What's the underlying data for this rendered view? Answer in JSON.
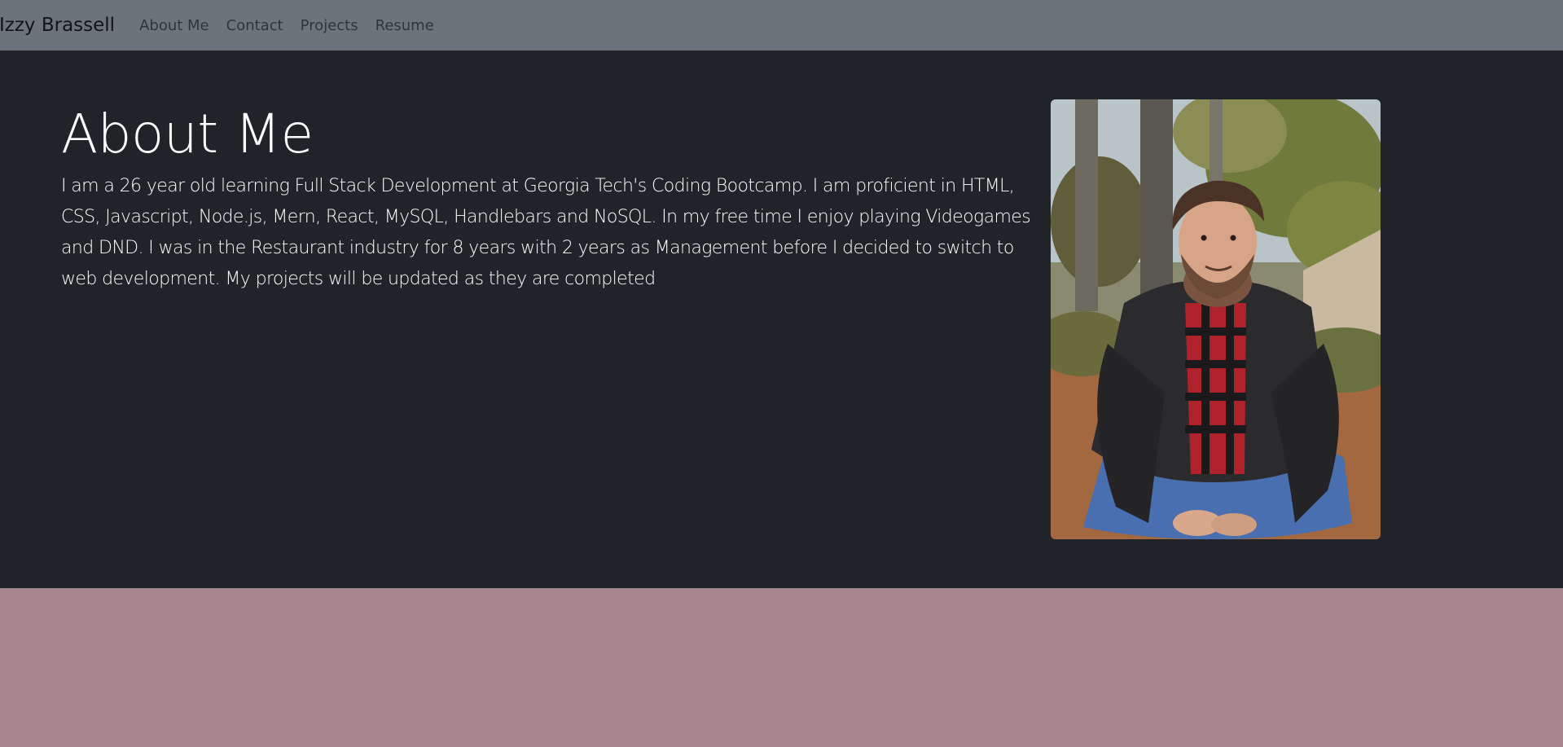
{
  "navbar": {
    "brand": "Izzy Brassell",
    "links": [
      {
        "label": "About Me"
      },
      {
        "label": "Contact"
      },
      {
        "label": "Projects"
      },
      {
        "label": "Resume"
      }
    ]
  },
  "about": {
    "title": "About Me",
    "body": "I am a 26 year old learning Full Stack Development at Georgia Tech's Coding Bootcamp. I am proficient in HTML, CSS, Javascript, Node.js, Mern, React, MySQL, Handlebars and NoSQL. In my free time I enjoy playing Videogames and DND. I was in the Restaurant industry for 8 years with 2 years as Management before I decided to switch to web development. My projects will be updated as they are completed"
  },
  "colors": {
    "navbar_bg": "#6b737d",
    "hero_bg": "#202328",
    "footer_bg": "#a6878f"
  }
}
